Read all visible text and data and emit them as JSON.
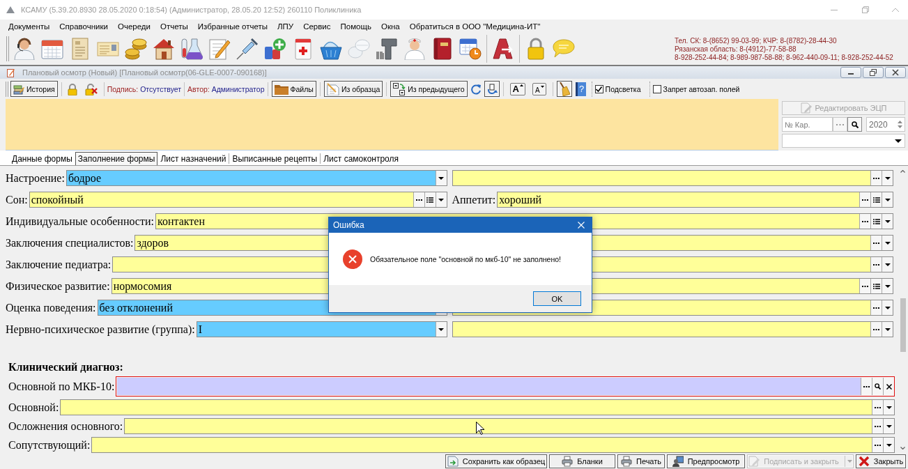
{
  "app_window": {
    "title": "КСАМУ (5.39.20.8930 28.05.2020 0:18:54) (Администратор, 28.05.20 12:52) 260110 Поликлиника"
  },
  "menu": [
    "Документы",
    "Справочники",
    "Очереди",
    "Отчеты",
    "Избранные отчеты",
    "ЛПУ",
    "Сервис",
    "Помощь",
    "Окна",
    "Обратиться в ООО \"Медицина-ИТ\""
  ],
  "contacts": [
    "Тел. СК: 8-(8652) 99-03-99; КЧР: 8-(8782)-28-44-30",
    "Рязанская область: 8-(4912)-77-58-88",
    "8-928-252-44-84; 8-989-987-58-88; 8-962-440-09-11; 8-928-252-44-52"
  ],
  "document_window": {
    "title": "Плановый осмотр (Новый) [Плановый осмотр(06-GLE-0007-090168)]",
    "toolbar": {
      "history_button": "История",
      "signature": {
        "label": "Подпись:",
        "value": "Отсутствует"
      },
      "author": {
        "label": "Автор:",
        "value": "Администратор"
      },
      "files_button": "Файлы",
      "from_template_button": "Из образца",
      "from_previous_button": "Из предыдущего",
      "font_size_buttons": [
        {
          "label": "A",
          "kind": "increase"
        },
        {
          "label": "A",
          "kind": "decrease"
        }
      ],
      "help_button": "?",
      "highlight": {
        "label": "Подсветка",
        "checked": true
      },
      "no_autofill": {
        "label": "Запрет автозап. полей",
        "checked": false
      }
    }
  },
  "header_panel": {
    "edit_signature_button": {
      "label": "Редактировать ЭЦП",
      "disabled": true
    },
    "card_number": {
      "placeholder": "№ Кар."
    },
    "year": "2020"
  },
  "tabs": [
    {
      "label": "Данные формы",
      "selected": false
    },
    {
      "label": "Заполнение формы",
      "selected": true
    },
    {
      "label": "Лист назначений",
      "selected": false
    },
    {
      "label": "Выписанные рецепты",
      "selected": false
    },
    {
      "label": "Лист самоконтроля",
      "selected": false
    }
  ],
  "form": {
    "rows": [
      {
        "cells": [
          {
            "label": "Настроение:",
            "field": {
              "kind": "select",
              "value": "бодрое"
            }
          },
          {
            "field": {
              "kind": "combo"
            }
          }
        ]
      },
      {
        "cells": [
          {
            "label": "Сон:",
            "field": {
              "kind": "combo_list",
              "value": "спокойный"
            }
          },
          {
            "label": "Аппетит:",
            "field": {
              "kind": "combo_list",
              "value": "хороший"
            }
          }
        ]
      },
      {
        "cells": [
          {
            "label": "Индивидуальные особенности:",
            "field": {
              "kind": "combo_list",
              "value": "контактен"
            }
          }
        ]
      },
      {
        "cells": [
          {
            "label": "Заключения специалистов:",
            "field": {
              "kind": "combo",
              "value": "здоров"
            }
          }
        ]
      },
      {
        "cells": [
          {
            "label": "Заключение педиатра:",
            "field": {
              "kind": "combo"
            }
          }
        ]
      },
      {
        "cells": [
          {
            "label": "Физическое развитие:",
            "field": {
              "kind": "combo_list",
              "value": "нормосомия"
            }
          }
        ]
      },
      {
        "cells": [
          {
            "label": "Оценка поведения:",
            "field": {
              "kind": "select",
              "value": "без отклонений"
            }
          },
          {
            "field": {
              "kind": "combo"
            }
          }
        ]
      },
      {
        "cells": [
          {
            "label": "Нервно-психическое развитие (группа):",
            "field": {
              "kind": "select",
              "value": "I"
            }
          },
          {
            "field": {
              "kind": "combo"
            }
          }
        ]
      }
    ],
    "section_title": "Клинический диагноз:",
    "diagnosis_rows": [
      {
        "cells": [
          {
            "label": "Основной по МКБ-10:",
            "field": {
              "kind": "code",
              "invalid": true
            }
          }
        ]
      },
      {
        "cells": [
          {
            "label": "Основной:",
            "field": {
              "kind": "combo",
              "invalid": false
            }
          }
        ]
      },
      {
        "cells": [
          {
            "label": "Осложнения основного:",
            "field": {
              "kind": "combo",
              "invalid": false
            }
          }
        ]
      },
      {
        "cells": [
          {
            "label": "Сопутствующий:",
            "field": {
              "kind": "combo",
              "invalid": false
            }
          }
        ]
      }
    ]
  },
  "dialog": {
    "title": "Ошибка",
    "message": "Обязательное поле \"основной по мкб-10\" не заполнено!",
    "button": "OK"
  },
  "bottom_buttons": [
    {
      "label": "Сохранить как образец",
      "kind": "button",
      "disabled": false
    },
    {
      "label": "Бланки",
      "kind": "button",
      "disabled": false
    },
    {
      "label": "Печать",
      "kind": "button",
      "disabled": false
    },
    {
      "label": "Предпросмотр",
      "kind": "button",
      "disabled": false
    },
    {
      "label": "Подписать и закрыть",
      "kind": "split",
      "disabled": true
    },
    {
      "label": "Закрыть",
      "kind": "button",
      "disabled": false
    }
  ]
}
